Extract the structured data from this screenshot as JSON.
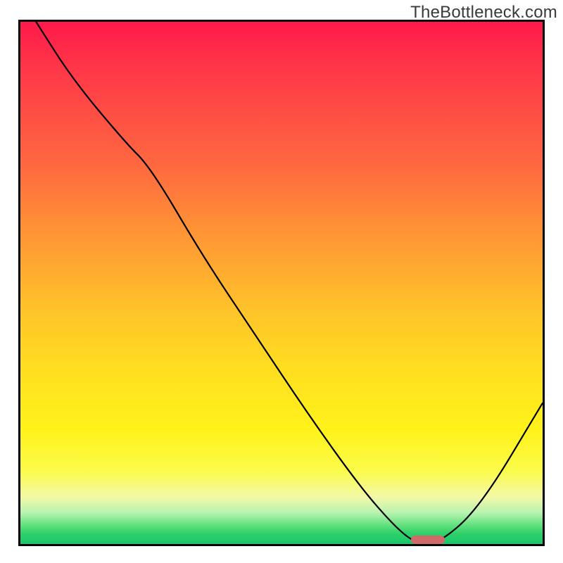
{
  "watermark": {
    "text": "TheBottleneck.com"
  },
  "chart_data": {
    "type": "line",
    "title": "",
    "xlabel": "",
    "ylabel": "",
    "xlim": [
      0,
      100
    ],
    "ylim": [
      0,
      100
    ],
    "grid": false,
    "legend": false,
    "series": [
      {
        "name": "bottleneck-curve",
        "x": [
          3,
          10,
          20,
          25,
          35,
          45,
          55,
          65,
          72,
          76,
          80,
          88,
          100
        ],
        "y": [
          100,
          89,
          77,
          72,
          55,
          40,
          25,
          11,
          3,
          0,
          0,
          7,
          27
        ]
      }
    ],
    "annotations": [
      {
        "name": "optimal-marker",
        "shape": "pill",
        "color": "#d06a6a",
        "x_center": 78,
        "y_center": 0.8,
        "width_pct": 6.5,
        "height_pct": 1.6
      }
    ],
    "background_gradient": {
      "orientation": "vertical",
      "stops": [
        {
          "pos": 0.0,
          "color": "#ff1a4b"
        },
        {
          "pos": 0.42,
          "color": "#ff9a34"
        },
        {
          "pos": 0.78,
          "color": "#fff21a"
        },
        {
          "pos": 0.94,
          "color": "#b8f3b0"
        },
        {
          "pos": 1.0,
          "color": "#18c86a"
        }
      ]
    }
  }
}
